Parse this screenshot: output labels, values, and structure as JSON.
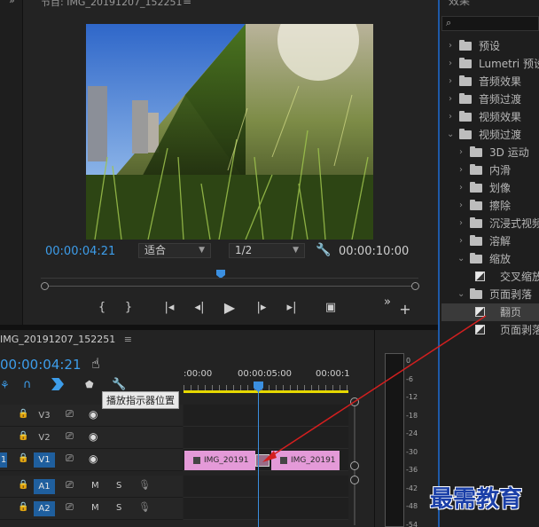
{
  "program_monitor": {
    "title": "节目: IMG_20191207_152251",
    "timecode_current": "00:00:04:21",
    "fit_value": "适合",
    "resolution_value": "1/2",
    "timecode_duration": "00:00:10:00"
  },
  "effects_panel": {
    "title": "效果",
    "items": [
      {
        "label": "预设",
        "type": "folder-star",
        "depth": 0,
        "expanded": false
      },
      {
        "label": "Lumetri 预设",
        "type": "folder-star",
        "depth": 0,
        "expanded": false
      },
      {
        "label": "音频效果",
        "type": "folder",
        "depth": 0,
        "expanded": false
      },
      {
        "label": "音频过渡",
        "type": "folder",
        "depth": 0,
        "expanded": false
      },
      {
        "label": "视频效果",
        "type": "folder",
        "depth": 0,
        "expanded": false
      },
      {
        "label": "视频过渡",
        "type": "folder",
        "depth": 0,
        "expanded": true
      },
      {
        "label": "3D 运动",
        "type": "folder",
        "depth": 1,
        "expanded": false
      },
      {
        "label": "内滑",
        "type": "folder",
        "depth": 1,
        "expanded": false
      },
      {
        "label": "划像",
        "type": "folder",
        "depth": 1,
        "expanded": false
      },
      {
        "label": "擦除",
        "type": "folder",
        "depth": 1,
        "expanded": false
      },
      {
        "label": "沉浸式视频",
        "type": "folder",
        "depth": 1,
        "expanded": false
      },
      {
        "label": "溶解",
        "type": "folder",
        "depth": 1,
        "expanded": false
      },
      {
        "label": "缩放",
        "type": "folder",
        "depth": 1,
        "expanded": true
      },
      {
        "label": "交叉缩放",
        "type": "effect",
        "depth": 2,
        "expanded": false
      },
      {
        "label": "页面剥落",
        "type": "folder",
        "depth": 1,
        "expanded": true
      },
      {
        "label": "翻页",
        "type": "effect",
        "depth": 2,
        "expanded": false,
        "selected": true
      },
      {
        "label": "页面剥落",
        "type": "effect",
        "depth": 2,
        "expanded": false
      }
    ]
  },
  "timeline": {
    "sequence_name": "IMG_20191207_152251",
    "timecode": "00:00:04:21",
    "ruler_labels": [
      ":00:00",
      "00:00:05:00",
      "00:00:1"
    ],
    "tooltip": "播放指示器位置",
    "tracks": [
      {
        "name": "V3",
        "kind": "video",
        "active": false
      },
      {
        "name": "V2",
        "kind": "video",
        "active": false
      },
      {
        "name": "V1",
        "kind": "video",
        "active": true,
        "source_label": "1"
      },
      {
        "name": "A1",
        "kind": "audio",
        "active": true,
        "m": "M",
        "s": "S"
      },
      {
        "name": "A2",
        "kind": "audio",
        "active": true,
        "m": "M",
        "s": "S"
      }
    ],
    "clips": [
      {
        "name": "IMG_20191"
      },
      {
        "name": "IMG_20191"
      }
    ]
  },
  "audio_meter": {
    "db_labels": [
      "0",
      "-6",
      "-12",
      "-18",
      "-24",
      "-30",
      "-36",
      "-42",
      "-48",
      "-54"
    ]
  },
  "watermark": "最需教育",
  "colors": {
    "accent_blue": "#3d9dea",
    "clip_pink": "#e49ad8",
    "playhead_blue": "#3b8fe0",
    "arrow_red": "#d31f1f"
  }
}
